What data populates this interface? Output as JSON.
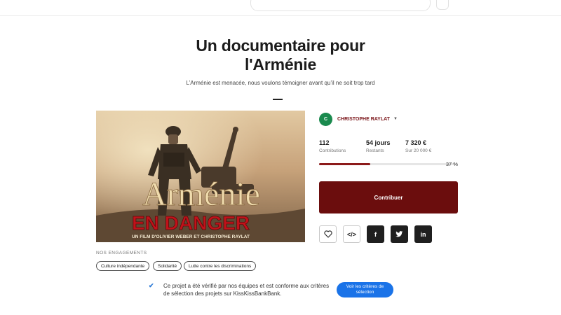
{
  "project": {
    "title_line1": "Un documentaire pour",
    "title_line2": "l'Arménie",
    "subtitle": "L’Arménie est menacée, nous voulons témoigner avant qu’il ne soit trop tard"
  },
  "video": {
    "title_main": "Arménie",
    "title_sub": "EN DANGER",
    "credits": "UN FILM D'OLIVIER WEBER ET CHRISTOPHE RAYLAT"
  },
  "creator": {
    "initial": "C",
    "name": "CHRISTOPHE RAYLAT",
    "avatar_color": "#1a8a4e"
  },
  "stats": {
    "contributions_value": "112",
    "contributions_label": "Contributions",
    "days_value": "54 jours",
    "days_label": "Restants",
    "amount_value": "7 320 €",
    "amount_label": "Sur 20 000 €"
  },
  "progress": {
    "fraction": 0.37,
    "percent_label": "37 %",
    "fill_color": "#8c1a1a"
  },
  "actions": {
    "contribute_label": "Contribuer",
    "embed_label": "</>",
    "facebook_label": "f",
    "linkedin_label": "in",
    "icons": [
      "heart-icon",
      "embed-icon",
      "facebook-icon",
      "twitter-icon",
      "linkedin-icon"
    ]
  },
  "engagements": {
    "title": "NOS ENGAGEMENTS",
    "tags": [
      "Culture indépendante",
      "Solidarité",
      "Lutte contre les discriminations"
    ]
  },
  "verification": {
    "text": "Ce projet a été vérifié par nos équipes et est conforme aux critères de sélection des projets sur KissKissBankBank.",
    "button_label": "Voir les critères de sélection",
    "check": "✔"
  },
  "colors": {
    "brand_dark_red": "#6b0d0d",
    "creator_red": "#7a1418",
    "link_blue": "#1a73e8"
  }
}
